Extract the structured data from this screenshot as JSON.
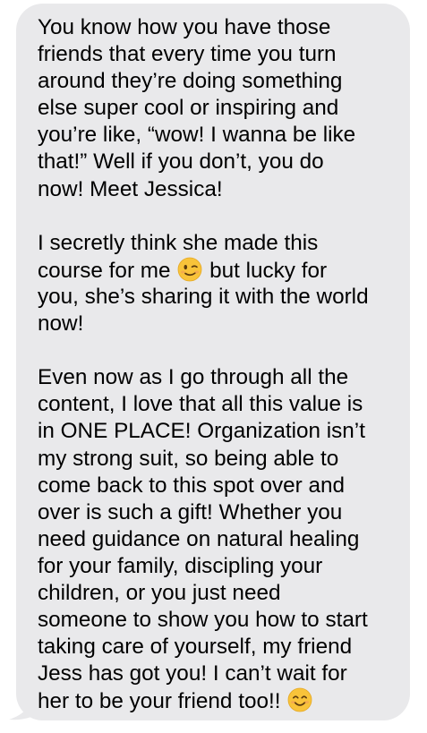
{
  "message": {
    "p1": [
      "You know how you have those",
      "friends that every time you turn",
      "around they’re doing something",
      "else super cool or inspiring and",
      "you’re like, “wow! I wanna be like",
      "that!” Well if you don’t, you do",
      "now! Meet Jessica!"
    ],
    "p2": {
      "l1_before": "I secretly think she made this",
      "l2_before": "course for me",
      "l2_emoji": "winking-face",
      "l2_after": "but lucky for",
      "l3": "you, she’s sharing it with the world",
      "l4": "now!"
    },
    "p3": [
      "Even now as I go through all the",
      "content, I love that all this value is",
      "in ONE PLACE! Organization isn’t",
      "my strong suit, so being able to",
      "come back to this spot over and",
      "over is such a gift! Whether you",
      "need guidance on natural healing",
      "for your family, discipling your",
      "children, or you just need",
      "someone to show you how to start",
      "taking care of yourself,  my friend",
      "Jess has got you! I can’t wait for"
    ],
    "last_line": "her to be your friend too!!",
    "last_emoji": "smiling-face-with-smiling-eyes"
  },
  "colors": {
    "bubble_bg": "#e9e9eb",
    "text": "#000000",
    "emoji_yellow": "#f8c33a"
  }
}
